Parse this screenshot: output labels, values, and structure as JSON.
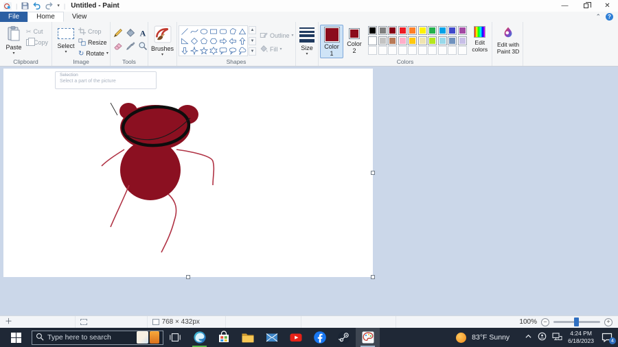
{
  "window": {
    "title": "Untitled - Paint"
  },
  "menu": {
    "file": "File",
    "home": "Home",
    "view": "View"
  },
  "ribbon": {
    "clipboard": {
      "group_label": "Clipboard",
      "paste": "Paste",
      "cut": "Cut",
      "copy": "Copy"
    },
    "image": {
      "group_label": "Image",
      "select": "Select",
      "crop": "Crop",
      "resize": "Resize",
      "rotate": "Rotate"
    },
    "tools": {
      "group_label": "Tools"
    },
    "brushes": {
      "label": "Brushes"
    },
    "shapes": {
      "group_label": "Shapes",
      "outline": "Outline",
      "fill": "Fill",
      "items": [
        "line",
        "curve",
        "ellipse",
        "rectangle",
        "rounded-rectangle",
        "polygon",
        "triangle",
        "right-triangle",
        "diamond",
        "pentagon",
        "hexagon",
        "arrow-right",
        "arrow-left",
        "arrow-up",
        "arrow-down",
        "star-4",
        "star-5",
        "star-6",
        "callout-rounded",
        "callout-oval",
        "callout-cloud"
      ]
    },
    "size": {
      "label": "Size"
    },
    "colors": {
      "group_label": "Colors",
      "color1_label": "Color 1",
      "color2_label": "Color 2",
      "color1_value": "#8b0c1c",
      "color2_value": "#8b0c1c",
      "palette_row1": [
        "#000000",
        "#7f7f7f",
        "#880015",
        "#ed1c24",
        "#ff7f27",
        "#fff200",
        "#22b14c",
        "#00a2e8",
        "#3f48cc",
        "#a349a4"
      ],
      "palette_row2": [
        "#ffffff",
        "#c3c3c3",
        "#b97a57",
        "#ffaec9",
        "#ffc90e",
        "#efe4b0",
        "#b5e61d",
        "#99d9ea",
        "#7092be",
        "#c8bfe7"
      ],
      "palette_empty": 10,
      "edit_colors": "Edit colors"
    },
    "paint3d": {
      "label": "Edit with Paint 3D"
    }
  },
  "canvas": {
    "tooltip_title": "Selection",
    "tooltip_body": "Select a part of the picture",
    "drawing_colors": {
      "body_fill": "#8b1021",
      "head_outline": "#0d0d0d",
      "limb_stroke": "#b03244"
    }
  },
  "statusbar": {
    "image_size": "768 × 432px",
    "zoom_level": "100%"
  },
  "taskbar": {
    "search_placeholder": "Type here to search",
    "apps": [
      "edge",
      "store",
      "explorer",
      "mail",
      "youtube",
      "facebook",
      "steam",
      "paint"
    ],
    "active_apps": [
      "edge",
      "paint"
    ],
    "highlighted_app": "paint",
    "weather": {
      "temp": "83°F",
      "condition": "Sunny"
    },
    "clock": {
      "time": "4:24 PM",
      "date": "6/18/2023"
    },
    "notification_count": "4"
  },
  "icon_names": [
    "paint-app-icon",
    "save-icon",
    "undo-icon",
    "redo-icon",
    "customize-toolbar-icon",
    "minimize-icon",
    "restore-icon",
    "close-icon",
    "help-icon",
    "minimize-ribbon-icon",
    "paste-icon",
    "scissors-icon",
    "copy-icon",
    "select-icon",
    "crop-icon",
    "resize-icon",
    "rotate-icon",
    "pencil-icon",
    "fill-bucket-icon",
    "text-icon",
    "eraser-icon",
    "color-picker-icon",
    "magnifier-icon",
    "brush-icon",
    "outline-icon",
    "shape-fill-icon",
    "size-icon",
    "edit-colors-icon",
    "paint3d-icon",
    "cursor-position-icon",
    "selection-size-icon",
    "image-size-icon",
    "zoom-out-icon",
    "zoom-in-icon",
    "start-icon",
    "search-icon",
    "task-view-icon",
    "sun-icon",
    "chevron-up-icon",
    "people-icon",
    "network-icon",
    "notification-icon"
  ]
}
